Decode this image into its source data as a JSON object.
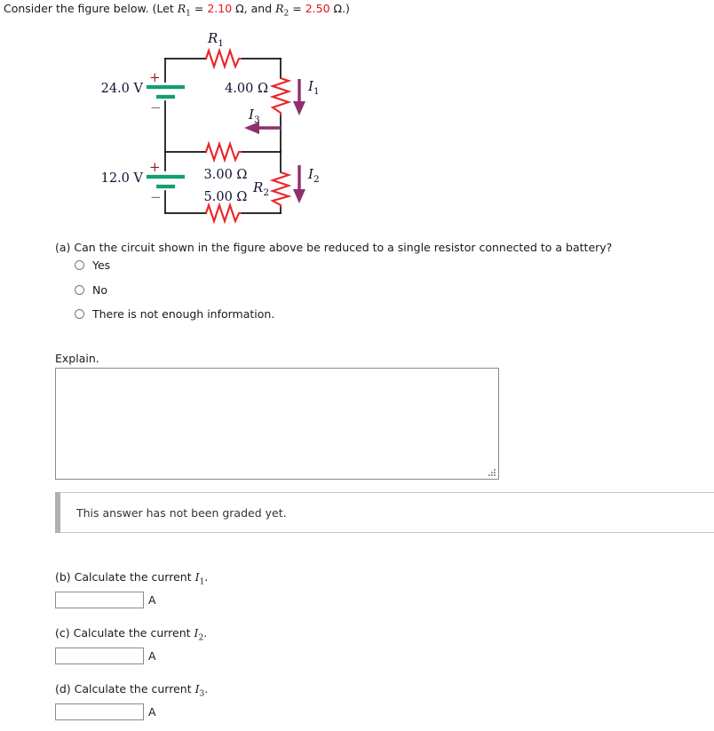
{
  "prompt": {
    "lead": "Consider the figure below. (Let ",
    "r1_symbol": "R",
    "r1_sub": "1",
    "eq1": " = ",
    "r1_value": "2.10",
    "unit1": " Ω, and ",
    "r2_symbol": "R",
    "r2_sub": "2",
    "eq2": " = ",
    "r2_value": "2.50",
    "unit2": " Ω.)",
    "value_color": "#e8121a"
  },
  "figure": {
    "type": "circuit-diagram",
    "colors": {
      "wire": "#111111",
      "resistor": "#e8262a",
      "battery": "#11a06e",
      "current_arrow": "#8e2f6e",
      "plus_sign": "#8a2020",
      "minus_sign": "#7a7a7a",
      "label": "#101030"
    },
    "components": [
      {
        "name": "R1",
        "label": "R",
        "sub": "1",
        "kind": "resistor",
        "position": "top-branch"
      },
      {
        "name": "battery-24",
        "label": "24.0 V",
        "kind": "battery",
        "position": "upper-left"
      },
      {
        "name": "resistor-4ohm",
        "label": "4.00 Ω",
        "kind": "resistor",
        "position": "upper-right"
      },
      {
        "name": "resistor-3ohm",
        "label": "3.00 Ω",
        "kind": "resistor",
        "position": "middle-branch"
      },
      {
        "name": "battery-12",
        "label": "12.0 V",
        "kind": "battery",
        "position": "lower-left"
      },
      {
        "name": "R2",
        "label": "R",
        "sub": "2",
        "kind": "resistor",
        "position": "lower-right"
      },
      {
        "name": "resistor-5ohm",
        "label": "5.00 Ω",
        "kind": "resistor",
        "position": "bottom-branch"
      }
    ],
    "currents": [
      {
        "name": "I1",
        "label": "I",
        "sub": "1",
        "direction": "down",
        "position": "upper-right"
      },
      {
        "name": "I3",
        "label": "I",
        "sub": "3",
        "direction": "left",
        "position": "middle-branch"
      },
      {
        "name": "I2",
        "label": "I",
        "sub": "2",
        "direction": "down",
        "position": "lower-right"
      }
    ],
    "battery_polarity": {
      "plus": "+",
      "minus": "−"
    }
  },
  "question_a": {
    "text": "(a) Can the circuit shown in the figure above be reduced to a single resistor connected to a battery?",
    "options": [
      {
        "label": "Yes",
        "selected": false
      },
      {
        "label": "No",
        "selected": false
      },
      {
        "label": "There is not enough information.",
        "selected": false
      }
    ]
  },
  "explain": {
    "label": "Explain.",
    "value": "",
    "placeholder": ""
  },
  "notice": {
    "text": "This answer has not been graded yet."
  },
  "parts": [
    {
      "id": "b",
      "prefix": "(b) Calculate the current ",
      "symbol": "I",
      "sub": "1",
      "suffix": ".",
      "value": "",
      "unit": "A"
    },
    {
      "id": "c",
      "prefix": "(c) Calculate the current ",
      "symbol": "I",
      "sub": "2",
      "suffix": ".",
      "value": "",
      "unit": "A"
    },
    {
      "id": "d",
      "prefix": "(d) Calculate the current ",
      "symbol": "I",
      "sub": "3",
      "suffix": ".",
      "value": "",
      "unit": "A"
    }
  ]
}
